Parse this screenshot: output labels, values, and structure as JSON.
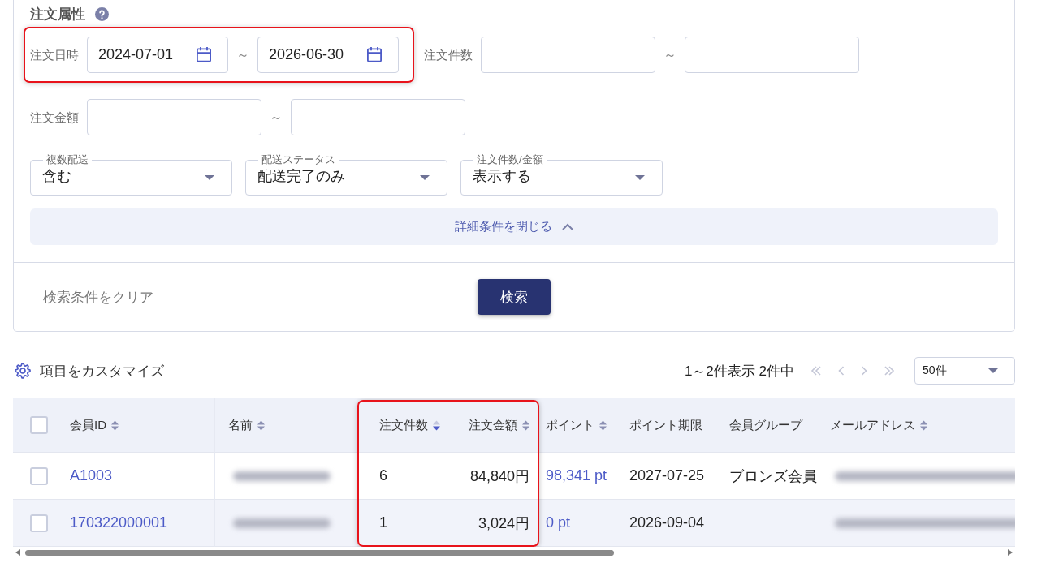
{
  "order_attributes": {
    "title": "注文属性",
    "ranges": [
      {
        "kind": "date",
        "label": "注文日時",
        "from": "2024-07-01",
        "separator": "～",
        "to": "2026-06-30",
        "highlighted": true
      },
      {
        "kind": "number",
        "label": "注文件数",
        "separator": "～",
        "highlighted": false
      },
      {
        "kind": "number",
        "label": "注文金額",
        "separator": "～",
        "highlighted": false
      }
    ],
    "dropdowns": [
      {
        "label": "複数配送",
        "value": "含む"
      },
      {
        "label": "配送ステータス",
        "value": "配送完了のみ"
      },
      {
        "label": "注文件数/金額",
        "value": "表示する"
      }
    ],
    "detail_toggle": {
      "label": "詳細条件を閉じる",
      "expanded": true
    },
    "actions": [
      {
        "kind": "link",
        "label": "検索条件をクリア"
      },
      {
        "kind": "primary",
        "label": "検索"
      }
    ]
  },
  "toolbar": {
    "customize": "項目をカスタマイズ",
    "summary": "1～2件表示 2件中",
    "pager": [
      {
        "kind": "first",
        "disabled": true
      },
      {
        "kind": "prev",
        "disabled": true
      },
      {
        "kind": "next",
        "disabled": true
      },
      {
        "kind": "last",
        "disabled": true
      }
    ],
    "per_page": "50件"
  },
  "table": {
    "select_all": {
      "checked": false
    },
    "columns": [
      {
        "label": "会員ID",
        "kind": "link",
        "sortable": true,
        "sorted": false,
        "highlighted": false
      },
      {
        "label": "名前",
        "kind": "text",
        "sortable": true,
        "sorted": false,
        "highlighted": false
      },
      {
        "label": "注文件数",
        "kind": "text",
        "sortable": true,
        "sorted": true,
        "highlighted": true
      },
      {
        "label": "注文金額",
        "kind": "amount",
        "sortable": true,
        "sorted": false,
        "highlighted": true
      },
      {
        "label": "ポイント",
        "kind": "link",
        "sortable": true,
        "sorted": false,
        "highlighted": false
      },
      {
        "label": "ポイント期限",
        "kind": "text",
        "sortable": false,
        "highlighted": false
      },
      {
        "label": "会員グループ",
        "kind": "text",
        "sortable": false,
        "highlighted": false
      },
      {
        "label": "メールアドレス",
        "kind": "text",
        "sortable": true,
        "sorted": false,
        "highlighted": false
      }
    ],
    "rows": [
      {
        "checked": false,
        "cells": [
          {
            "text": "A1003",
            "redacted": false
          },
          {
            "redacted": true
          },
          {
            "text": "6",
            "redacted": false
          },
          {
            "text": "84,840円",
            "redacted": false
          },
          {
            "text": "98,341 pt",
            "redacted": false
          },
          {
            "text": "2027-07-25",
            "redacted": false
          },
          {
            "text": "ブロンズ会員",
            "redacted": false
          },
          {
            "redacted": true
          }
        ]
      },
      {
        "checked": false,
        "cells": [
          {
            "text": "170322000001",
            "redacted": false
          },
          {
            "redacted": true
          },
          {
            "text": "1",
            "redacted": false
          },
          {
            "text": "3,024円",
            "redacted": false
          },
          {
            "text": "0 pt",
            "redacted": false
          },
          {
            "text": "2026-09-04",
            "redacted": false
          },
          {
            "redacted": false
          },
          {
            "redacted": true
          }
        ]
      }
    ]
  }
}
